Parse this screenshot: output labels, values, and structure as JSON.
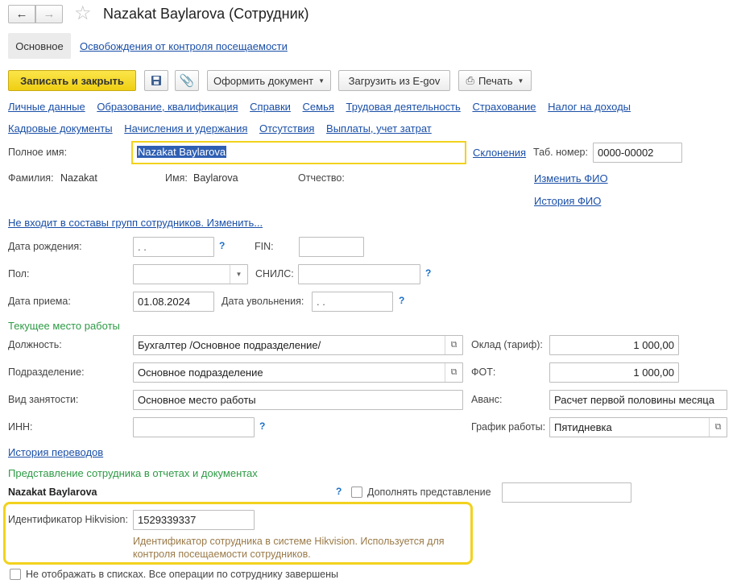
{
  "window": {
    "title": "Nazakat Baylarova (Сотрудник)"
  },
  "nav_tabs": [
    {
      "label": "Основное"
    },
    {
      "label": "Освобождения от контроля посещаемости"
    }
  ],
  "toolbar": {
    "save_close": "Записать и закрыть",
    "create_doc": "Оформить документ",
    "load_egov": "Загрузить из E-gov",
    "print": "Печать"
  },
  "sections_row1": [
    "Личные данные",
    "Образование, квалификация",
    "Справки",
    "Семья",
    "Трудовая деятельность",
    "Страхование",
    "Налог на доходы"
  ],
  "sections_row2": [
    "Кадровые документы",
    "Начисления и удержания",
    "Отсутствия",
    "Выплаты, учет затрат"
  ],
  "personal": {
    "fullname_label": "Полное имя:",
    "fullname_value": "Nazakat Baylarova",
    "declensions_link": "Склонения",
    "tab_label": "Таб. номер:",
    "tab_value": "0000-00002",
    "surname_label": "Фамилия:",
    "surname_value": "Nazakat",
    "name_label": "Имя:",
    "name_value": "Baylarova",
    "patronymic_label": "Отчество:",
    "change_fio_link": "Изменить ФИО",
    "history_fio_link": "История ФИО",
    "groups_link": "Не входит в составы групп сотрудников. Изменить..."
  },
  "details": {
    "birth_label": "Дата рождения:",
    "birth_value": " .  .",
    "fin_label": "FIN:",
    "sex_label": "Пол:",
    "snils_label": "СНИЛС:",
    "hire_label": "Дата приема:",
    "hire_value": "01.08.2024",
    "dismiss_label": "Дата увольнения:",
    "dismiss_value": " .  .",
    "help": "?"
  },
  "workplace": {
    "group_title": "Текущее место работы",
    "position_label": "Должность:",
    "position_value": "Бухгалтер /Основное подразделение/",
    "department_label": "Подразделение:",
    "department_value": "Основное подразделение",
    "employment_label": "Вид занятости:",
    "employment_value": "Основное место работы",
    "inn_label": "ИНН:",
    "salary_label": "Оклад (тариф):",
    "salary_value": "1 000,00",
    "fot_label": "ФОТ:",
    "fot_value": "1 000,00",
    "advance_label": "Аванс:",
    "advance_value": "Расчет первой половины месяца",
    "schedule_label": "График работы:",
    "schedule_value": "Пятидневка",
    "transfers_link": "История переводов"
  },
  "representation": {
    "group_title": "Представление сотрудника в отчетах и документах",
    "name": "Nazakat Baylarova",
    "supplement_label": "Дополнять представление"
  },
  "hikvision": {
    "label": "Идентификатор Hikvision:",
    "value": "1529339337",
    "hint": "Идентификатор сотрудника в системе Hikvision. Используется для контроля посещаемости сотрудников."
  },
  "footer": {
    "hide_label": "Не отображать в списках. Все операции по сотруднику завершены"
  },
  "colors": {
    "accent_yellow": "#f2d21e",
    "link_blue": "#1a4fa8",
    "group_green": "#2e9a45",
    "hint_brown": "#9a7a48"
  }
}
